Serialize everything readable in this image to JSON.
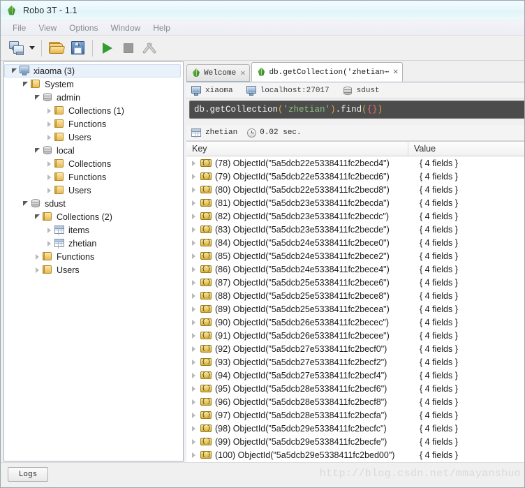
{
  "window": {
    "title": "Robo 3T - 1.1",
    "app_icon": "leaf-icon"
  },
  "menu": {
    "items": [
      "File",
      "View",
      "Options",
      "Window",
      "Help"
    ]
  },
  "toolbar": {
    "buttons": [
      {
        "name": "connect-button",
        "icon": "connect-icon",
        "label": ""
      },
      {
        "name": "connect-dropdown",
        "icon": "chevron-down-icon",
        "label": ""
      },
      {
        "name": "open-script-button",
        "icon": "folder-open-icon",
        "label": ""
      },
      {
        "name": "save-script-button",
        "icon": "save-icon",
        "label": ""
      },
      {
        "name": "execute-button",
        "icon": "play-icon",
        "label": ""
      },
      {
        "name": "stop-button",
        "icon": "stop-icon",
        "label": ""
      },
      {
        "name": "options-button",
        "icon": "tools-icon",
        "label": ""
      }
    ]
  },
  "tree": [
    {
      "label": "xiaoma (3)",
      "icon": "server-icon",
      "indent": 0,
      "state": "expanded",
      "selected": true
    },
    {
      "label": "System",
      "icon": "folder-icon",
      "indent": 1,
      "state": "expanded",
      "selected": false
    },
    {
      "label": "admin",
      "icon": "database-icon",
      "indent": 2,
      "state": "expanded",
      "selected": false
    },
    {
      "label": "Collections (1)",
      "icon": "folder-icon",
      "indent": 3,
      "state": "collapsed",
      "selected": false
    },
    {
      "label": "Functions",
      "icon": "folder-icon",
      "indent": 3,
      "state": "collapsed",
      "selected": false
    },
    {
      "label": "Users",
      "icon": "folder-icon",
      "indent": 3,
      "state": "collapsed",
      "selected": false
    },
    {
      "label": "local",
      "icon": "database-icon",
      "indent": 2,
      "state": "expanded",
      "selected": false
    },
    {
      "label": "Collections",
      "icon": "folder-icon",
      "indent": 3,
      "state": "collapsed",
      "selected": false
    },
    {
      "label": "Functions",
      "icon": "folder-icon",
      "indent": 3,
      "state": "collapsed",
      "selected": false
    },
    {
      "label": "Users",
      "icon": "folder-icon",
      "indent": 3,
      "state": "collapsed",
      "selected": false
    },
    {
      "label": "sdust",
      "icon": "database-icon",
      "indent": 1,
      "state": "expanded",
      "selected": false
    },
    {
      "label": "Collections (2)",
      "icon": "folder-icon",
      "indent": 2,
      "state": "expanded",
      "selected": false
    },
    {
      "label": "items",
      "icon": "grid-icon",
      "indent": 3,
      "state": "collapsed",
      "selected": false
    },
    {
      "label": "zhetian",
      "icon": "grid-icon",
      "indent": 3,
      "state": "collapsed",
      "selected": false
    },
    {
      "label": "Functions",
      "icon": "folder-icon",
      "indent": 2,
      "state": "collapsed",
      "selected": false
    },
    {
      "label": "Users",
      "icon": "folder-icon",
      "indent": 2,
      "state": "collapsed",
      "selected": false
    }
  ],
  "tabs": [
    {
      "label": "Welcome",
      "icon": "leaf-icon",
      "active": false,
      "close": "✕"
    },
    {
      "label": "db.getCollection('zhetian⋯",
      "icon": "leaf-icon",
      "active": true,
      "close": "✕"
    }
  ],
  "connection_bar": [
    {
      "icon": "connection-icon",
      "label": "xiaoma"
    },
    {
      "icon": "server-icon",
      "label": "localhost:27017"
    },
    {
      "icon": "database-icon",
      "label": "sdust"
    }
  ],
  "editor": {
    "segments": [
      {
        "text": "db.getCollection",
        "kind": "plain"
      },
      {
        "text": "(",
        "kind": "paren"
      },
      {
        "text": "'zhetian'",
        "kind": "string"
      },
      {
        "text": ")",
        "kind": "paren"
      },
      {
        "text": ".find",
        "kind": "plain"
      },
      {
        "text": "(",
        "kind": "paren"
      },
      {
        "text": "{}",
        "kind": "brace"
      },
      {
        "text": ")",
        "kind": "paren"
      }
    ],
    "full_text": "db.getCollection('zhetian').find({})"
  },
  "result_meta": {
    "collection_icon": "grid-icon",
    "collection": "zhetian",
    "time_icon": "clock-icon",
    "time": "0.02 sec."
  },
  "results_table": {
    "columns": [
      "Key",
      "Value"
    ],
    "rows": [
      {
        "index": "(78)",
        "key": "ObjectId(\"5a5dcb22e5338411fc2becd4\")",
        "value": "{ 4 fields }"
      },
      {
        "index": "(79)",
        "key": "ObjectId(\"5a5dcb22e5338411fc2becd6\")",
        "value": "{ 4 fields }"
      },
      {
        "index": "(80)",
        "key": "ObjectId(\"5a5dcb22e5338411fc2becd8\")",
        "value": "{ 4 fields }"
      },
      {
        "index": "(81)",
        "key": "ObjectId(\"5a5dcb23e5338411fc2becda\")",
        "value": "{ 4 fields }"
      },
      {
        "index": "(82)",
        "key": "ObjectId(\"5a5dcb23e5338411fc2becdc\")",
        "value": "{ 4 fields }"
      },
      {
        "index": "(83)",
        "key": "ObjectId(\"5a5dcb23e5338411fc2becde\")",
        "value": "{ 4 fields }"
      },
      {
        "index": "(84)",
        "key": "ObjectId(\"5a5dcb24e5338411fc2bece0\")",
        "value": "{ 4 fields }"
      },
      {
        "index": "(85)",
        "key": "ObjectId(\"5a5dcb24e5338411fc2bece2\")",
        "value": "{ 4 fields }"
      },
      {
        "index": "(86)",
        "key": "ObjectId(\"5a5dcb24e5338411fc2bece4\")",
        "value": "{ 4 fields }"
      },
      {
        "index": "(87)",
        "key": "ObjectId(\"5a5dcb25e5338411fc2bece6\")",
        "value": "{ 4 fields }"
      },
      {
        "index": "(88)",
        "key": "ObjectId(\"5a5dcb25e5338411fc2bece8\")",
        "value": "{ 4 fields }"
      },
      {
        "index": "(89)",
        "key": "ObjectId(\"5a5dcb25e5338411fc2becea\")",
        "value": "{ 4 fields }"
      },
      {
        "index": "(90)",
        "key": "ObjectId(\"5a5dcb26e5338411fc2becec\")",
        "value": "{ 4 fields }"
      },
      {
        "index": "(91)",
        "key": "ObjectId(\"5a5dcb26e5338411fc2becee\")",
        "value": "{ 4 fields }"
      },
      {
        "index": "(92)",
        "key": "ObjectId(\"5a5dcb27e5338411fc2becf0\")",
        "value": "{ 4 fields }"
      },
      {
        "index": "(93)",
        "key": "ObjectId(\"5a5dcb27e5338411fc2becf2\")",
        "value": "{ 4 fields }"
      },
      {
        "index": "(94)",
        "key": "ObjectId(\"5a5dcb27e5338411fc2becf4\")",
        "value": "{ 4 fields }"
      },
      {
        "index": "(95)",
        "key": "ObjectId(\"5a5dcb28e5338411fc2becf6\")",
        "value": "{ 4 fields }"
      },
      {
        "index": "(96)",
        "key": "ObjectId(\"5a5dcb28e5338411fc2becf8\")",
        "value": "{ 4 fields }"
      },
      {
        "index": "(97)",
        "key": "ObjectId(\"5a5dcb28e5338411fc2becfa\")",
        "value": "{ 4 fields }"
      },
      {
        "index": "(98)",
        "key": "ObjectId(\"5a5dcb29e5338411fc2becfc\")",
        "value": "{ 4 fields }"
      },
      {
        "index": "(99)",
        "key": "ObjectId(\"5a5dcb29e5338411fc2becfe\")",
        "value": "{ 4 fields }"
      },
      {
        "index": "(100)",
        "key": "ObjectId(\"5a5dcb29e5338411fc2bed00\")",
        "value": "{ 4 fields }"
      }
    ]
  },
  "bottom": {
    "logs_label": "Logs"
  },
  "watermark": {
    "text": "http://blog.csdn.net/mmayanshuo"
  },
  "colors": {
    "titlebar": "#eaf8fb",
    "editor_bg": "#4c4c4c",
    "editor_string": "#8ec07c",
    "editor_paren": "#e8a33d",
    "accent_green": "#2f9e2f",
    "selection": "#e9f1fb"
  }
}
